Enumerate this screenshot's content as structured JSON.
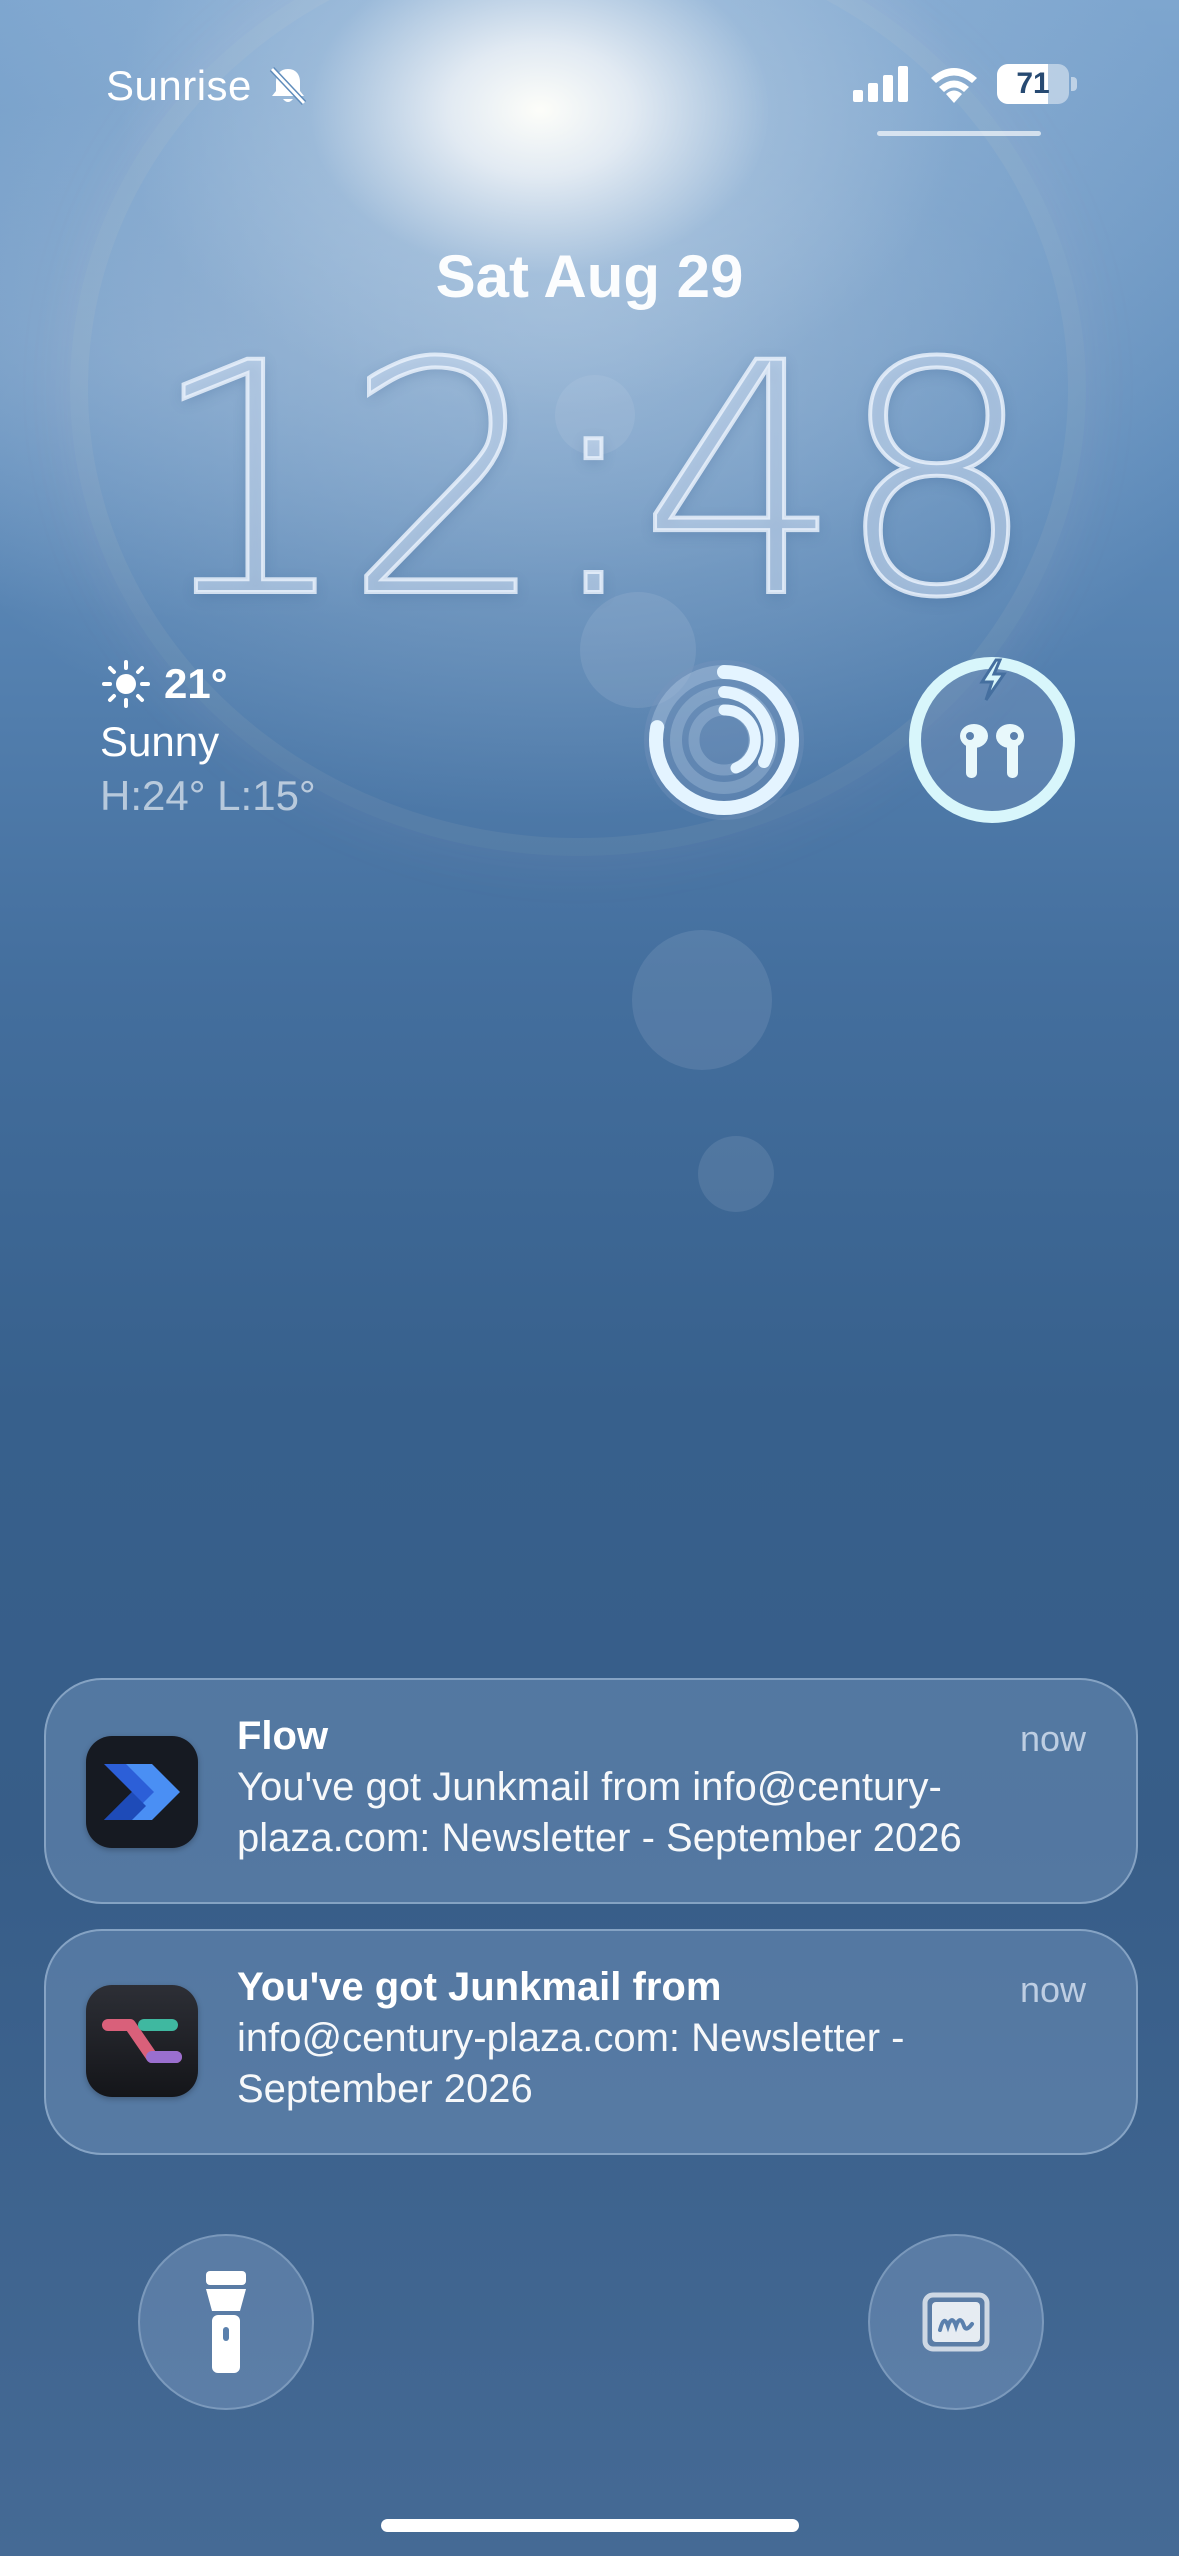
{
  "status_bar": {
    "carrier": "Sunrise",
    "silent_icon": "bell-slash-icon",
    "signal_icon": "cellular-signal-icon",
    "wifi_icon": "wifi-icon",
    "battery_percent": "71",
    "battery_level": 0.71
  },
  "lock_screen": {
    "date": "Sat Aug 29",
    "time": "12:48"
  },
  "weather": {
    "icon": "sun-icon",
    "temperature": "21°",
    "condition": "Sunny",
    "high_low": "H:24° L:15°"
  },
  "widgets": {
    "activity_ring_icon": "activity-rings-icon",
    "activity_ring_progress": 0.78,
    "airpods_icon": "airpods-charging-icon",
    "airpods_battery": 1.0
  },
  "notifications": [
    {
      "app_icon": "flow-app-icon",
      "title": "Flow",
      "time": "now",
      "body": "You've got Junkmail from info@century-plaza.com: Newsletter - September 2026"
    },
    {
      "app_icon": "shortcut-app-icon",
      "title": "You've got Junkmail from",
      "time": "now",
      "body": "info@century-plaza.com: Newsletter - September 2026"
    }
  ],
  "quick_actions": {
    "left_icon": "flashlight-icon",
    "right_icon": "freeform-icon"
  },
  "colors": {
    "flow_accent": "#3b7cf0",
    "widget_accent": "#d8f6fb"
  }
}
